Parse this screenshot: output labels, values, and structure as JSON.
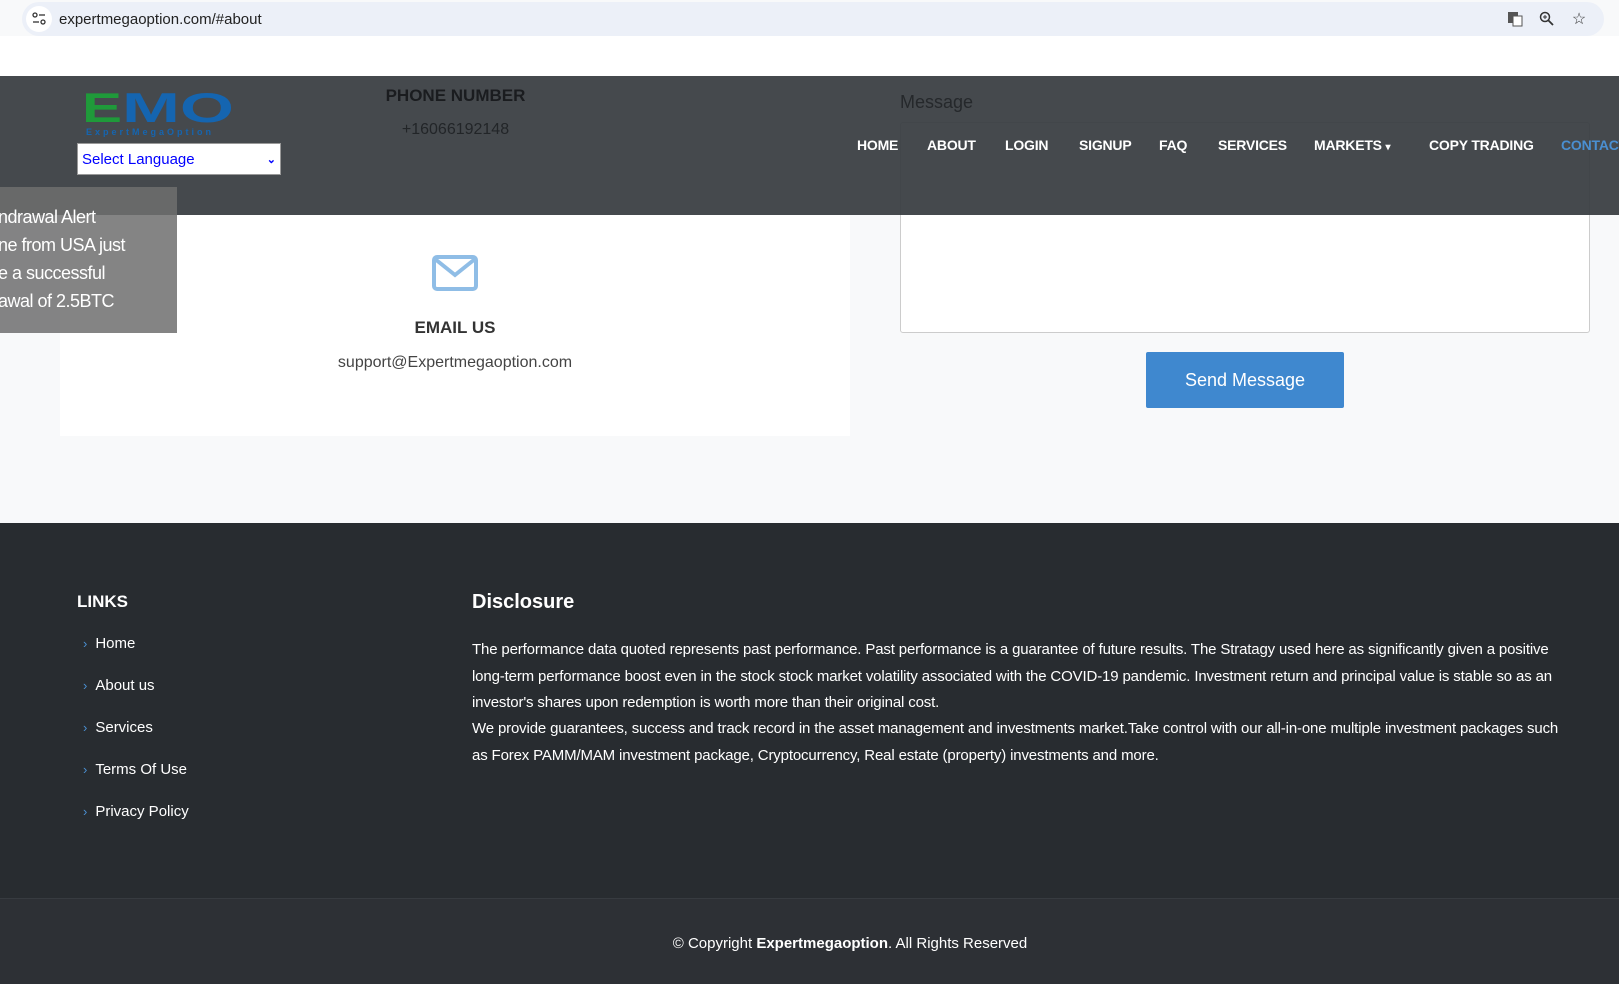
{
  "browser": {
    "url": "expertmegaoption.com/#about"
  },
  "header": {
    "logo_text": "EMO",
    "logo_sub": "ExpertMegaOption",
    "language_select": "Select Language",
    "nav": [
      {
        "label": "HOME"
      },
      {
        "label": "ABOUT"
      },
      {
        "label": "LOGIN"
      },
      {
        "label": "SIGNUP"
      },
      {
        "label": "FAQ"
      },
      {
        "label": "SERVICES"
      },
      {
        "label": "MARKETS"
      },
      {
        "label": "COPY TRADING"
      },
      {
        "label": "CONTACT"
      }
    ]
  },
  "contact": {
    "phone_title": "PHONE NUMBER",
    "phone_value": "+16066192148",
    "email_title": "EMAIL US",
    "email_value": "support@Expertmegaoption.com",
    "message_label": "Message",
    "send_button": "Send Message"
  },
  "notification": {
    "lines": [
      "ndrawal Alert",
      "ne from USA just",
      "e a successful",
      "awal of 2.5BTC"
    ]
  },
  "footer": {
    "links_title": "LINKS",
    "links": [
      {
        "label": "Home"
      },
      {
        "label": "About us"
      },
      {
        "label": "Services"
      },
      {
        "label": "Terms Of Use"
      },
      {
        "label": "Privacy Policy"
      }
    ],
    "disclosure_title": "Disclosure",
    "disclosure_lines": [
      "The performance data quoted represents past performance. Past performance is a guarantee of future results. The Stratagy used here as significantly given a positive",
      "long-term performance boost even in the stock stock market volatility associated with the COVID-19 pandemic. Investment return and principal value is stable so as an",
      "investor's shares upon redemption is worth more than their original cost.",
      "We provide guarantees, success and track record in the asset management and investments market.Take control with our all-in-one multiple investment packages such",
      "as Forex PAMM/MAM investment package, Cryptocurrency, Real estate (property) investments and more."
    ],
    "copyright_prefix": "© Copyright ",
    "copyright_brand": "Expertmegaoption",
    "copyright_suffix": ". All Rights Reserved"
  },
  "colors": {
    "accent": "#3f88cf",
    "header": "#373b3f",
    "footer": "#282c30",
    "logo_green": "#1f9a3a",
    "logo_blue": "#1565b0"
  }
}
